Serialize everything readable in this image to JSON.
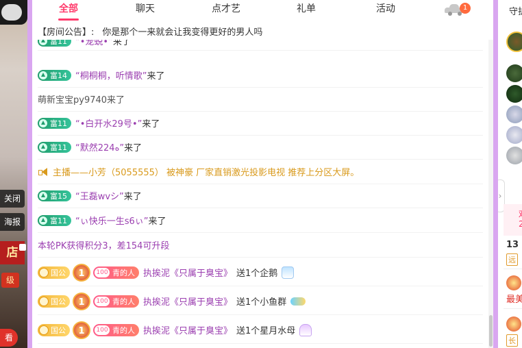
{
  "video_strip": {
    "close_label": "关闭",
    "poster_label": "海报",
    "shop_label": "店",
    "level_label": "级",
    "look_label": "看"
  },
  "tabs": [
    {
      "label": "全部",
      "active": true
    },
    {
      "label": "聊天",
      "active": false
    },
    {
      "label": "点才艺",
      "active": false
    },
    {
      "label": "礼单",
      "active": false
    },
    {
      "label": "活动",
      "active": false
    }
  ],
  "car_tab": {
    "icon": "car-icon",
    "badge": "1"
  },
  "announcement": {
    "label": "【房间公告】:",
    "text": "你是那个一来就会让我变得更好的男人吗"
  },
  "messages": [
    {
      "kind": "enter",
      "badge": "富11",
      "name": "“•宠蜕•”",
      "suffix": "来了",
      "partial": true
    },
    {
      "kind": "enter",
      "badge": "富14",
      "name": "“桐桐桐，听情歌”",
      "suffix": "来了"
    },
    {
      "kind": "plain",
      "text": "萌新宝宝py9740来了"
    },
    {
      "kind": "enter",
      "badge": "富11",
      "name": "“•白开水29号•”",
      "suffix": "来了"
    },
    {
      "kind": "enter",
      "badge": "富11",
      "name": "“默然224ه”",
      "suffix": "来了"
    },
    {
      "kind": "host",
      "text": "主播——小芳（5055555） 被神豪 厂家直销激光投影电视 推荐上分区大屏。"
    },
    {
      "kind": "enter",
      "badge": "富15",
      "name": "“王磊wvシ”",
      "suffix": "来了"
    },
    {
      "kind": "enter",
      "badge": "富11",
      "name": "“ぃ快乐一生s6ぃ”",
      "suffix": "来了"
    },
    {
      "kind": "pk",
      "text": "本轮PK获得积分3，差154可升段"
    },
    {
      "kind": "gift",
      "guogong": "国公",
      "medal": "1",
      "fan_level": "100",
      "fan_name": "青的人",
      "sender": "执挨泥《只属于臭宝》",
      "action": "送1个企鹅",
      "gift_icon": "penguin-gift-icon"
    },
    {
      "kind": "gift",
      "guogong": "国公",
      "medal": "1",
      "fan_level": "100",
      "fan_name": "青的人",
      "sender": "执挨泥《只属于臭宝》",
      "action": "送1个小鱼群",
      "gift_icon": "fish-gift-icon"
    },
    {
      "kind": "gift",
      "guogong": "国公",
      "medal": "1",
      "fan_level": "100",
      "fan_name": "青的人",
      "sender": "执挨泥《只属于臭宝》",
      "action": "送1个星月水母",
      "gift_icon": "jellyfish-gift-icon"
    }
  ],
  "sidebar": {
    "title": "守护",
    "pink_a": "欢",
    "pink_b": "2",
    "rank_count": "13",
    "rank_tag": "远",
    "most_label": "最美",
    "long_tag": "长"
  },
  "colors": {
    "accent": "#ff3a6b",
    "purple_border": "#d9a6f0",
    "name_purple": "#9b3fb0",
    "host_gold": "#d99a1c",
    "fu_green": "#1f9d6c"
  }
}
